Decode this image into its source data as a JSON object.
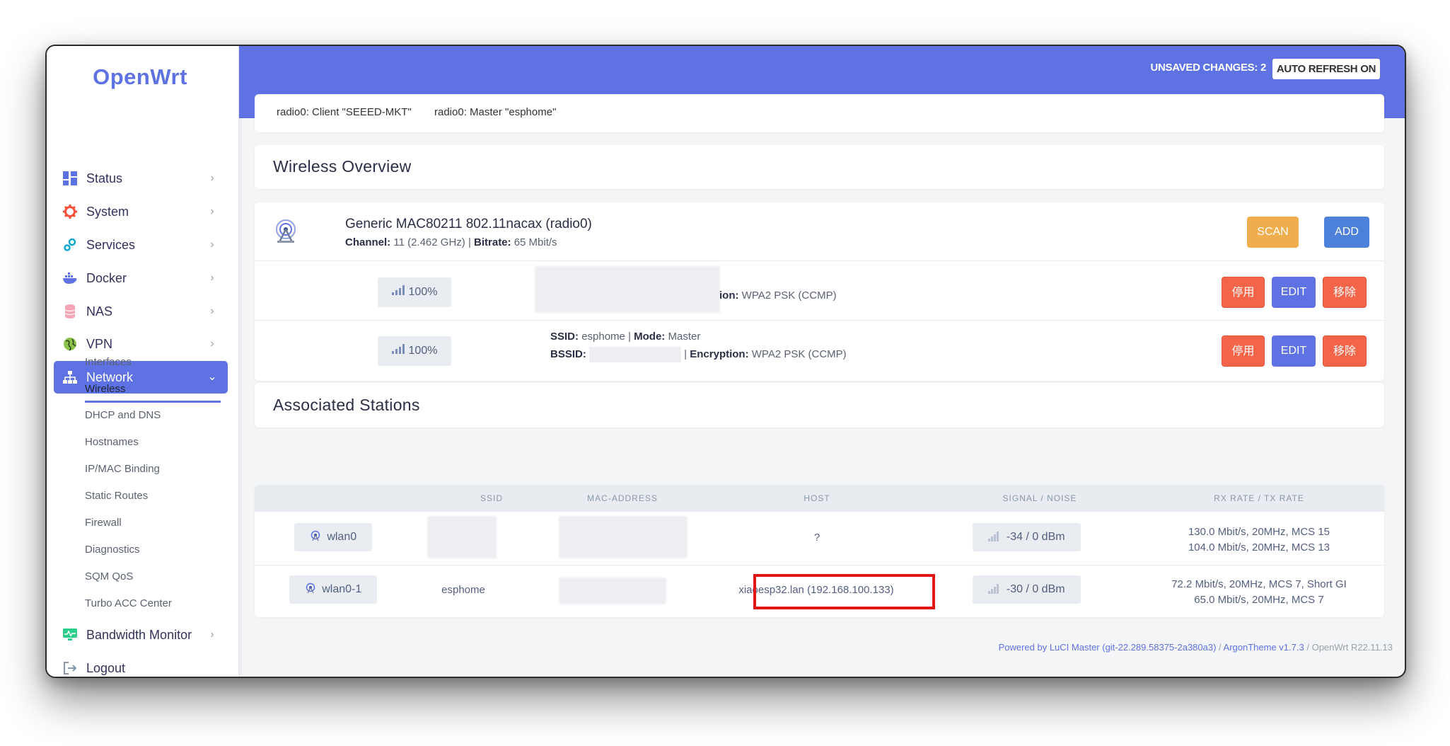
{
  "brand": "OpenWrt",
  "header": {
    "unsaved": "UNSAVED CHANGES: 2",
    "auto_refresh": "AUTO REFRESH ON"
  },
  "sidebar": {
    "items": [
      {
        "label": "Status",
        "icon": "dashboard-icon"
      },
      {
        "label": "System",
        "icon": "gear-icon"
      },
      {
        "label": "Services",
        "icon": "cogs-icon"
      },
      {
        "label": "Docker",
        "icon": "docker-icon"
      },
      {
        "label": "NAS",
        "icon": "database-icon"
      },
      {
        "label": "VPN",
        "icon": "globe-icon"
      },
      {
        "label": "Network",
        "icon": "network-icon"
      },
      {
        "label": "Bandwidth Monitor",
        "icon": "monitor-icon"
      },
      {
        "label": "Logout",
        "icon": "logout-icon"
      }
    ],
    "network_sub": [
      "Interfaces",
      "Wireless",
      "DHCP and DNS",
      "Hostnames",
      "IP/MAC Binding",
      "Static Routes",
      "Firewall",
      "Diagnostics",
      "SQM QoS",
      "Turbo ACC Center"
    ],
    "active_sub": "Wireless"
  },
  "tabs": [
    "radio0: Client \"SEEED-MKT\"",
    "radio0: Master \"esphome\""
  ],
  "wireless": {
    "title": "Wireless Overview",
    "device": {
      "name": "Generic MAC80211 802.11nacax (radio0)",
      "channel_label": "Channel:",
      "channel_value": "11 (2.462 GHz)",
      "bitrate_label": "Bitrate:",
      "bitrate_value": "65 Mbit/s",
      "scan": "SCAN",
      "add": "ADD"
    },
    "networks": [
      {
        "signal": "100%",
        "encryption_label_partial": "ion:",
        "encryption_value": "WPA2 PSK (CCMP)",
        "disable": "停用",
        "edit": "EDIT",
        "remove": "移除"
      },
      {
        "signal": "100%",
        "ssid_label": "SSID:",
        "ssid_value": "esphome",
        "mode_label": "Mode:",
        "mode_value": "Master",
        "bssid_label": "BSSID:",
        "encryption_label": "Encryption:",
        "encryption_value": "WPA2 PSK (CCMP)",
        "disable": "停用",
        "edit": "EDIT",
        "remove": "移除"
      }
    ]
  },
  "stations": {
    "title": "Associated Stations",
    "columns": [
      "SSID",
      "MAC-ADDRESS",
      "HOST",
      "SIGNAL / NOISE",
      "RX RATE / TX RATE"
    ],
    "rows": [
      {
        "iface": "wlan0",
        "ssid": "",
        "host": "?",
        "signal": "-34 / 0 dBm",
        "rx": "130.0 Mbit/s, 20MHz, MCS 15",
        "tx": "104.0 Mbit/s, 20MHz, MCS 13"
      },
      {
        "iface": "wlan0-1",
        "ssid": "esphome",
        "host": "xiaoesp32.lan (192.168.100.133)",
        "signal": "-30 / 0 dBm",
        "rx": "72.2 Mbit/s, 20MHz, MCS 7, Short GI",
        "tx": "65.0 Mbit/s, 20MHz, MCS 7"
      }
    ]
  },
  "footer": {
    "luci": "Powered by LuCI Master (git-22.289.58375-2a380a3)",
    "sep1": " / ",
    "theme": "ArgonTheme v1.7.3",
    "sep2": " / ",
    "version": "OpenWrt R22.11.13"
  },
  "colors": {
    "accent": "#5e72e4",
    "warning": "#f0ad4e",
    "danger": "#f36449",
    "highlight": "#e31515"
  }
}
